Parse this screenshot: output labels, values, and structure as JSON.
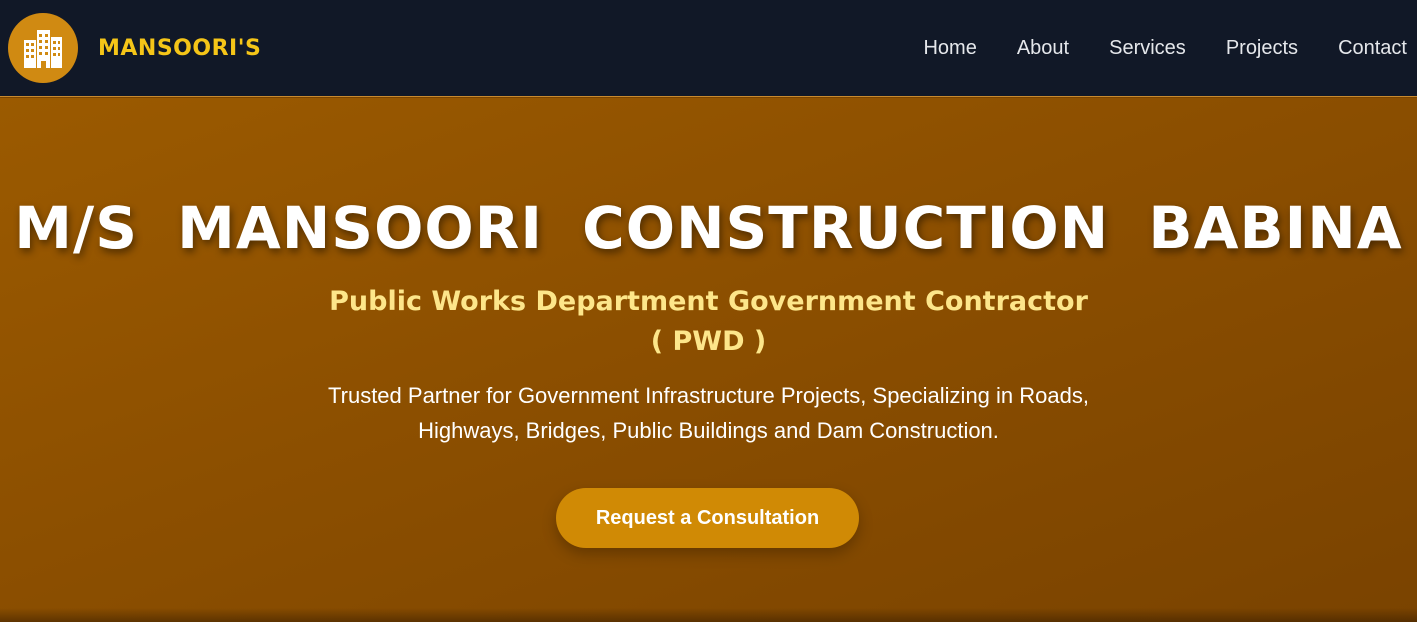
{
  "header": {
    "brand_name": "MANSOORI'S",
    "logo_icon": "buildings-icon",
    "nav": [
      {
        "label": "Home"
      },
      {
        "label": "About"
      },
      {
        "label": "Services"
      },
      {
        "label": "Projects"
      },
      {
        "label": "Contact"
      }
    ]
  },
  "hero": {
    "title": "M/S MANSOORI CONSTRUCTION BABINA",
    "subtitle_line1": "Public Works Department Government Contractor",
    "subtitle_line2": "( PWD )",
    "description_line1": "Trusted Partner for Government Infrastructure Projects, Specializing in Roads,",
    "description_line2": "Highways, Bridges, Public Buildings and Dam Construction.",
    "cta_label": "Request a Consultation"
  },
  "colors": {
    "navbar_bg": "#111827",
    "brand_accent": "#f5c518",
    "hero_bg": "#8c4f00",
    "subtitle": "#fde68a",
    "cta_bg": "#d08a05"
  }
}
